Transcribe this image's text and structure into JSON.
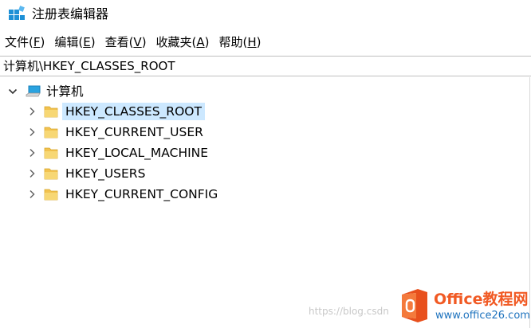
{
  "window": {
    "title": "注册表编辑器",
    "icon": "registry-editor-icon"
  },
  "menu": [
    {
      "label": "文件(",
      "accel": "F",
      "suffix": ")"
    },
    {
      "label": "编辑(",
      "accel": "E",
      "suffix": ")"
    },
    {
      "label": "查看(",
      "accel": "V",
      "suffix": ")"
    },
    {
      "label": "收藏夹(",
      "accel": "A",
      "suffix": ")"
    },
    {
      "label": "帮助(",
      "accel": "H",
      "suffix": ")"
    }
  ],
  "address": {
    "path": "计算机\\HKEY_CLASSES_ROOT"
  },
  "tree": {
    "root": {
      "label": "计算机",
      "icon": "computer-icon",
      "expanded": true
    },
    "children": [
      {
        "label": "HKEY_CLASSES_ROOT",
        "icon": "folder-icon",
        "selected": true
      },
      {
        "label": "HKEY_CURRENT_USER",
        "icon": "folder-icon",
        "selected": false
      },
      {
        "label": "HKEY_LOCAL_MACHINE",
        "icon": "folder-icon",
        "selected": false
      },
      {
        "label": "HKEY_USERS",
        "icon": "folder-icon",
        "selected": false
      },
      {
        "label": "HKEY_CURRENT_CONFIG",
        "icon": "folder-icon",
        "selected": false
      }
    ]
  },
  "watermark": {
    "url": "https://blog.csdn",
    "brand_name": "Office教程网",
    "brand_site": "www.office26.com"
  },
  "colors": {
    "selection": "#cce8ff",
    "folder": "#f2c24f",
    "brand_orange": "#f15a24",
    "brand_blue": "#1e73be"
  }
}
